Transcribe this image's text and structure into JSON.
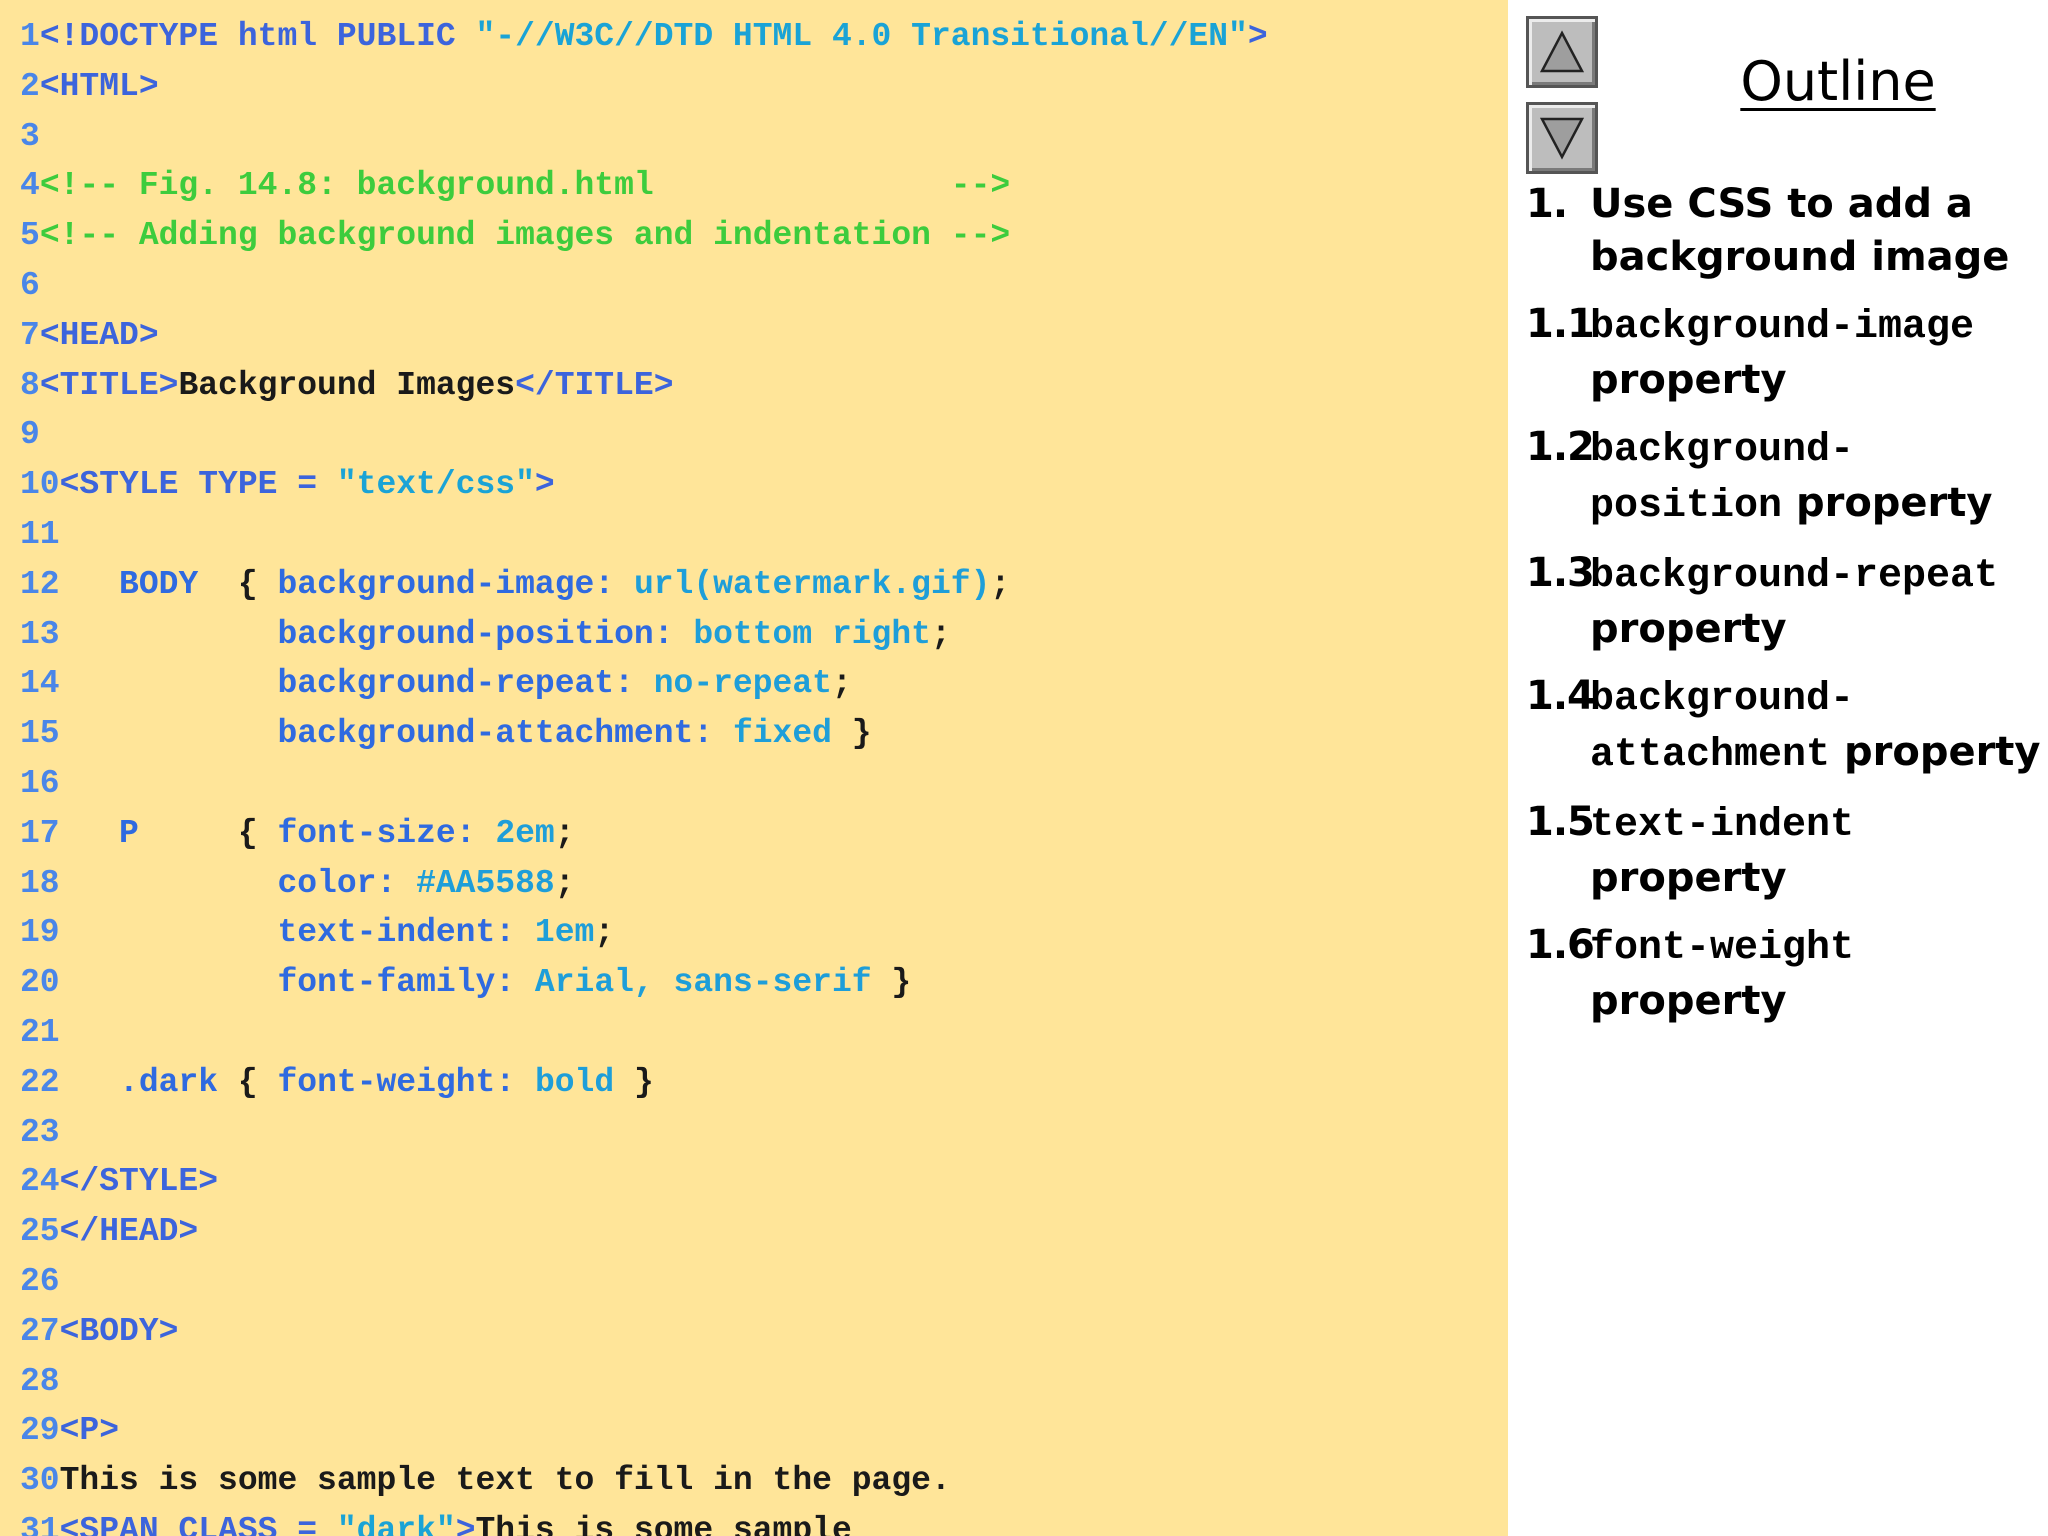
{
  "code": {
    "lines": [
      {
        "n": "1",
        "segs": [
          [
            "tag",
            "<!DOCTYPE html PUBLIC "
          ],
          [
            "str",
            "\"-//W3C//DTD HTML 4.0 Transitional//EN\""
          ],
          [
            "tag",
            ">"
          ]
        ]
      },
      {
        "n": "2",
        "segs": [
          [
            "tag",
            "<HTML>"
          ]
        ]
      },
      {
        "n": "3",
        "segs": []
      },
      {
        "n": "4",
        "segs": [
          [
            "cmt",
            "<!-- Fig. 14.8: background.html               -->"
          ]
        ]
      },
      {
        "n": "5",
        "segs": [
          [
            "cmt",
            "<!-- Adding background images and indentation -->"
          ]
        ]
      },
      {
        "n": "6",
        "segs": []
      },
      {
        "n": "7",
        "segs": [
          [
            "tag",
            "<HEAD>"
          ]
        ]
      },
      {
        "n": "8",
        "segs": [
          [
            "tag",
            "<TITLE>"
          ],
          [
            "txt",
            "Background Images"
          ],
          [
            "tag",
            "</TITLE>"
          ]
        ]
      },
      {
        "n": "9",
        "segs": []
      },
      {
        "n": "10",
        "segs": [
          [
            "tag",
            "<STYLE TYPE = "
          ],
          [
            "str",
            "\"text/css\""
          ],
          [
            "tag",
            ">"
          ]
        ]
      },
      {
        "n": "11",
        "segs": []
      },
      {
        "n": "12",
        "segs": [
          [
            "txt",
            "   "
          ],
          [
            "prop",
            "BODY"
          ],
          [
            "txt",
            "  { "
          ],
          [
            "prop",
            "background-image: "
          ],
          [
            "val",
            "url(watermark.gif)"
          ],
          [
            "txt",
            ";"
          ]
        ]
      },
      {
        "n": "13",
        "segs": [
          [
            "txt",
            "           "
          ],
          [
            "prop",
            "background-position: "
          ],
          [
            "val",
            "bottom right"
          ],
          [
            "txt",
            ";"
          ]
        ]
      },
      {
        "n": "14",
        "segs": [
          [
            "txt",
            "           "
          ],
          [
            "prop",
            "background-repeat: "
          ],
          [
            "val",
            "no-repeat"
          ],
          [
            "txt",
            ";"
          ]
        ]
      },
      {
        "n": "15",
        "segs": [
          [
            "txt",
            "           "
          ],
          [
            "prop",
            "background-attachment: "
          ],
          [
            "val",
            "fixed"
          ],
          [
            "txt",
            " }"
          ]
        ]
      },
      {
        "n": "16",
        "segs": []
      },
      {
        "n": "17",
        "segs": [
          [
            "txt",
            "   "
          ],
          [
            "prop",
            "P"
          ],
          [
            "txt",
            "     { "
          ],
          [
            "prop",
            "font-size: "
          ],
          [
            "val",
            "2em"
          ],
          [
            "txt",
            ";"
          ]
        ]
      },
      {
        "n": "18",
        "segs": [
          [
            "txt",
            "           "
          ],
          [
            "prop",
            "color: "
          ],
          [
            "val",
            "#AA5588"
          ],
          [
            "txt",
            ";"
          ]
        ]
      },
      {
        "n": "19",
        "segs": [
          [
            "txt",
            "           "
          ],
          [
            "prop",
            "text-indent: "
          ],
          [
            "val",
            "1em"
          ],
          [
            "txt",
            ";"
          ]
        ]
      },
      {
        "n": "20",
        "segs": [
          [
            "txt",
            "           "
          ],
          [
            "prop",
            "font-family: "
          ],
          [
            "val",
            "Arial, sans-serif"
          ],
          [
            "txt",
            " }"
          ]
        ]
      },
      {
        "n": "21",
        "segs": []
      },
      {
        "n": "22",
        "segs": [
          [
            "txt",
            "   "
          ],
          [
            "prop",
            ".dark"
          ],
          [
            "txt",
            " { "
          ],
          [
            "prop",
            "font-weight: "
          ],
          [
            "val",
            "bold"
          ],
          [
            "txt",
            " }"
          ]
        ]
      },
      {
        "n": "23",
        "segs": []
      },
      {
        "n": "24",
        "segs": [
          [
            "tag",
            "</STYLE>"
          ]
        ]
      },
      {
        "n": "25",
        "segs": [
          [
            "tag",
            "</HEAD>"
          ]
        ]
      },
      {
        "n": "26",
        "segs": []
      },
      {
        "n": "27",
        "segs": [
          [
            "tag",
            "<BODY>"
          ]
        ]
      },
      {
        "n": "28",
        "segs": []
      },
      {
        "n": "29",
        "segs": [
          [
            "tag",
            "<P>"
          ]
        ]
      },
      {
        "n": "30",
        "segs": [
          [
            "txt",
            "This is some sample text to fill in the page."
          ]
        ]
      },
      {
        "n": "31",
        "segs": [
          [
            "tag",
            "<SPAN CLASS = "
          ],
          [
            "str",
            "\"dark\""
          ],
          [
            "tag",
            ">"
          ],
          [
            "txt",
            "This is some sample"
          ]
        ]
      }
    ]
  },
  "outline": {
    "title": "Outline",
    "items": [
      {
        "num": "1.",
        "parts": [
          [
            "text",
            "Use CSS to add a background image"
          ]
        ]
      },
      {
        "num": "1.1",
        "parts": [
          [
            "mono",
            "background-image"
          ],
          [
            "text",
            " property"
          ]
        ]
      },
      {
        "num": "1.2",
        "parts": [
          [
            "mono",
            "background-position"
          ],
          [
            "text",
            " property"
          ]
        ]
      },
      {
        "num": "1.3",
        "parts": [
          [
            "mono",
            "background-repeat"
          ],
          [
            "text",
            " property"
          ]
        ]
      },
      {
        "num": "1.4",
        "parts": [
          [
            "mono",
            "background-attachment"
          ],
          [
            "text",
            " property"
          ]
        ]
      },
      {
        "num": "1.5",
        "parts": [
          [
            "mono",
            "text-indent"
          ],
          [
            "text",
            " property"
          ]
        ]
      },
      {
        "num": "1.6",
        "parts": [
          [
            "mono",
            "font-weight"
          ],
          [
            "text",
            " property"
          ]
        ]
      }
    ]
  },
  "nav": {
    "up_icon": "triangle-up-icon",
    "down_icon": "triangle-down-icon"
  },
  "colors": {
    "code_background": "#FFE599",
    "tag": "#3C64DC",
    "string": "#1AA3D6",
    "comment": "#3DCC3D",
    "line_number": "#4A86E8"
  }
}
